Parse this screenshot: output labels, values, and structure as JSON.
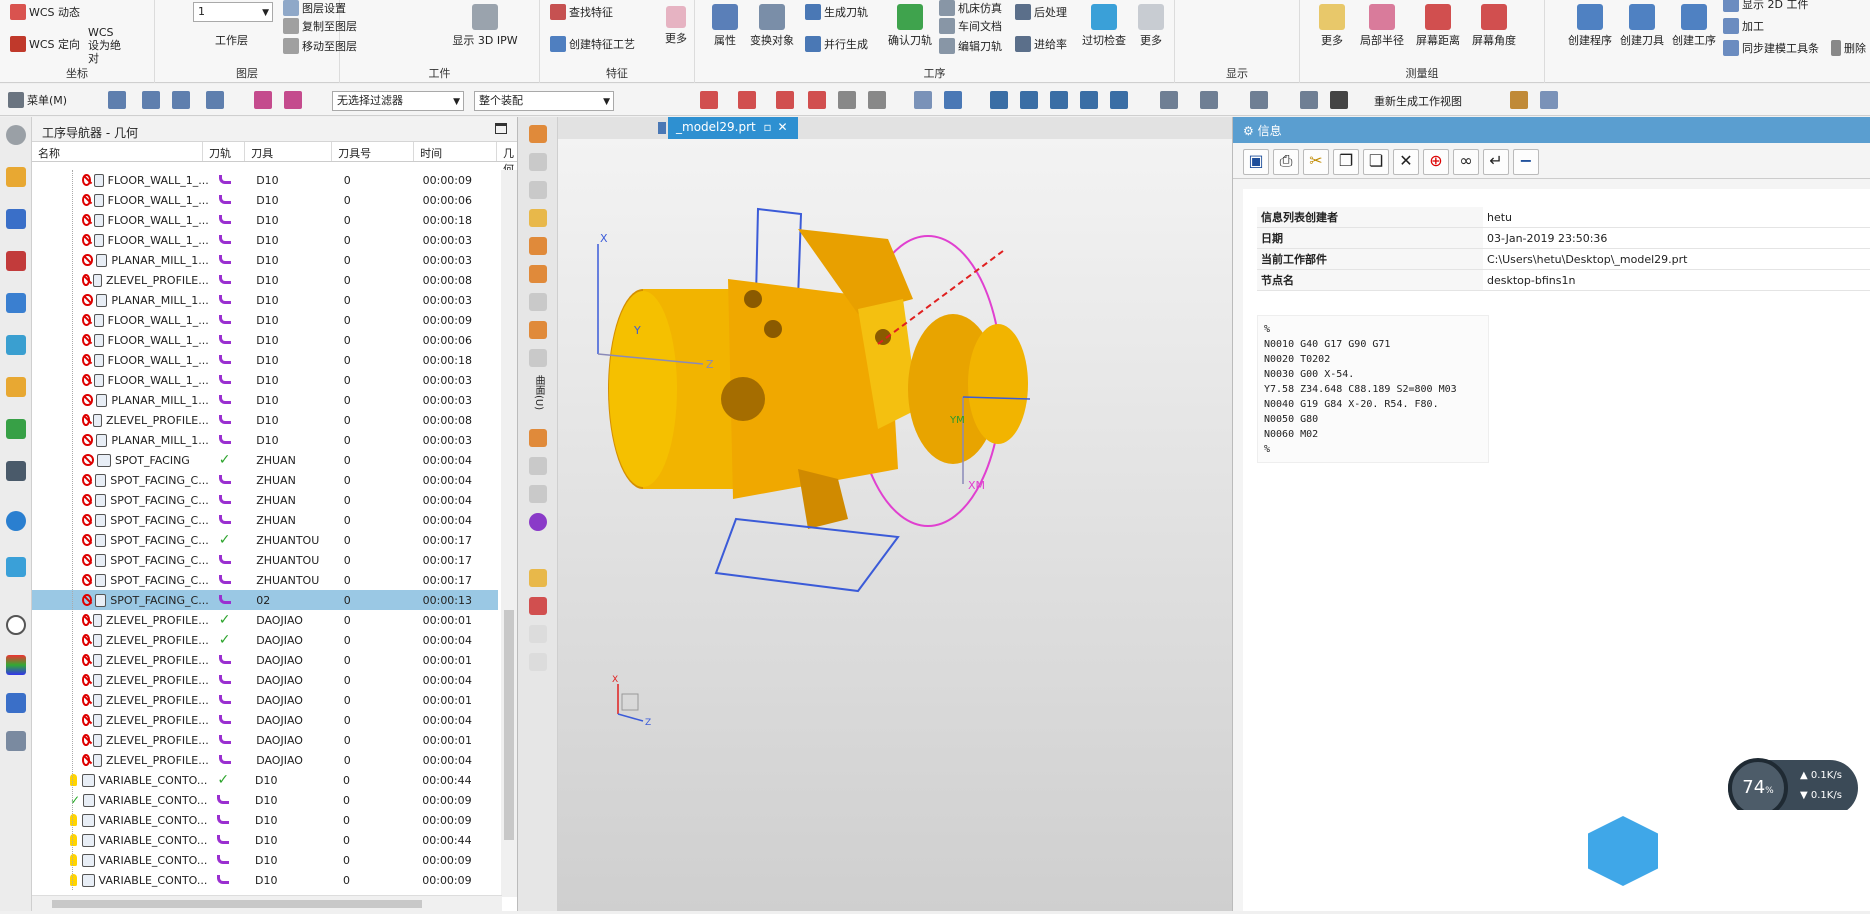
{
  "ribbon": {
    "groups": {
      "coord": "坐标",
      "layer": "图层",
      "workpiece": "工件",
      "feature": "特征",
      "process": "工序",
      "display": "显示",
      "measure": "测量组"
    },
    "coord_buttons": [
      "WCS 动态",
      "WCS 设为绝对",
      "WCS 定向"
    ],
    "layer_select": "1",
    "layer_buttons": [
      "工作层",
      "图层设置",
      "复制至图层",
      "移动至图层"
    ],
    "workpiece_buttons": [
      "显示 3D IPW"
    ],
    "feature_buttons": [
      "查找特征",
      "创建特征工艺",
      "更多"
    ],
    "process_buttons": [
      "属性",
      "变换对象",
      "生成刀轨",
      "并行生成",
      "确认刀轨",
      "机床仿真",
      "车间文档",
      "编辑刀轨",
      "后处理",
      "进给率",
      "过切检查",
      "更多"
    ],
    "measure_buttons": [
      "更多",
      "局部半径",
      "屏幕距离",
      "屏幕角度"
    ],
    "right_buttons": [
      "创建程序",
      "创建刀具",
      "创建工序",
      "显示 2D 工件",
      "加工",
      "同步建模工具条",
      "删除"
    ]
  },
  "quickbar": {
    "menu": "菜单(M)",
    "filter": "无选择过滤器",
    "assembly": "整个装配",
    "regen": "重新生成工作视图"
  },
  "navigator": {
    "title": "工序导航器 - 几何",
    "columns": [
      "名称",
      "刀轨",
      "刀具",
      "刀具号",
      "时间",
      "几何"
    ],
    "rows": [
      {
        "name": "FLOOR_WALL_1_...",
        "tool": "D10",
        "num": "0",
        "time": "00:00:09"
      },
      {
        "name": "FLOOR_WALL_1_...",
        "tool": "D10",
        "num": "0",
        "time": "00:00:06"
      },
      {
        "name": "FLOOR_WALL_1_...",
        "tool": "D10",
        "num": "0",
        "time": "00:00:18"
      },
      {
        "name": "FLOOR_WALL_1_...",
        "tool": "D10",
        "num": "0",
        "time": "00:00:03"
      },
      {
        "name": "PLANAR_MILL_1...",
        "tool": "D10",
        "num": "0",
        "time": "00:00:03"
      },
      {
        "name": "ZLEVEL_PROFILE...",
        "tool": "D10",
        "num": "0",
        "time": "00:00:08"
      },
      {
        "name": "PLANAR_MILL_1...",
        "tool": "D10",
        "num": "0",
        "time": "00:00:03"
      },
      {
        "name": "FLOOR_WALL_1_...",
        "tool": "D10",
        "num": "0",
        "time": "00:00:09"
      },
      {
        "name": "FLOOR_WALL_1_...",
        "tool": "D10",
        "num": "0",
        "time": "00:00:06"
      },
      {
        "name": "FLOOR_WALL_1_...",
        "tool": "D10",
        "num": "0",
        "time": "00:00:18"
      },
      {
        "name": "FLOOR_WALL_1_...",
        "tool": "D10",
        "num": "0",
        "time": "00:00:03"
      },
      {
        "name": "PLANAR_MILL_1...",
        "tool": "D10",
        "num": "0",
        "time": "00:00:03"
      },
      {
        "name": "ZLEVEL_PROFILE...",
        "tool": "D10",
        "num": "0",
        "time": "00:00:08"
      },
      {
        "name": "PLANAR_MILL_1...",
        "tool": "D10",
        "num": "0",
        "time": "00:00:03"
      },
      {
        "name": "SPOT_FACING",
        "tool": "ZHUAN",
        "num": "0",
        "time": "00:00:04"
      },
      {
        "name": "SPOT_FACING_C...",
        "tool": "ZHUAN",
        "num": "0",
        "time": "00:00:04"
      },
      {
        "name": "SPOT_FACING_C...",
        "tool": "ZHUAN",
        "num": "0",
        "time": "00:00:04"
      },
      {
        "name": "SPOT_FACING_C...",
        "tool": "ZHUAN",
        "num": "0",
        "time": "00:00:04"
      },
      {
        "name": "SPOT_FACING_C...",
        "tool": "ZHUANTOU",
        "num": "0",
        "time": "00:00:17"
      },
      {
        "name": "SPOT_FACING_C...",
        "tool": "ZHUANTOU",
        "num": "0",
        "time": "00:00:17"
      },
      {
        "name": "SPOT_FACING_C...",
        "tool": "ZHUANTOU",
        "num": "0",
        "time": "00:00:17"
      },
      {
        "name": "SPOT_FACING_C...",
        "tool": "02",
        "num": "0",
        "time": "00:00:13"
      },
      {
        "name": "ZLEVEL_PROFILE...",
        "tool": "DAOJIAO",
        "num": "0",
        "time": "00:00:01"
      },
      {
        "name": "ZLEVEL_PROFILE...",
        "tool": "DAOJIAO",
        "num": "0",
        "time": "00:00:04"
      },
      {
        "name": "ZLEVEL_PROFILE...",
        "tool": "DAOJIAO",
        "num": "0",
        "time": "00:00:01"
      },
      {
        "name": "ZLEVEL_PROFILE...",
        "tool": "DAOJIAO",
        "num": "0",
        "time": "00:00:04"
      },
      {
        "name": "ZLEVEL_PROFILE...",
        "tool": "DAOJIAO",
        "num": "0",
        "time": "00:00:01"
      },
      {
        "name": "ZLEVEL_PROFILE...",
        "tool": "DAOJIAO",
        "num": "0",
        "time": "00:00:04"
      },
      {
        "name": "ZLEVEL_PROFILE...",
        "tool": "DAOJIAO",
        "num": "0",
        "time": "00:00:01"
      },
      {
        "name": "ZLEVEL_PROFILE...",
        "tool": "DAOJIAO",
        "num": "0",
        "time": "00:00:04"
      },
      {
        "name": "VARIABLE_CONTO...",
        "tool": "D10",
        "num": "0",
        "time": "00:00:44"
      },
      {
        "name": "VARIABLE_CONTO...",
        "tool": "D10",
        "num": "0",
        "time": "00:00:09"
      },
      {
        "name": "VARIABLE_CONTO...",
        "tool": "D10",
        "num": "0",
        "time": "00:00:09"
      },
      {
        "name": "VARIABLE_CONTO...",
        "tool": "D10",
        "num": "0",
        "time": "00:00:44"
      },
      {
        "name": "VARIABLE_CONTO...",
        "tool": "D10",
        "num": "0",
        "time": "00:00:09"
      },
      {
        "name": "VARIABLE_CONTO...",
        "tool": "D10",
        "num": "0",
        "time": "00:00:09"
      }
    ]
  },
  "viewer": {
    "tab": "_model29.prt",
    "axis_labels": {
      "x": "X",
      "y": "Y",
      "z": "Z",
      "xm": "XM",
      "ym": "YM"
    },
    "side_label": "曲面(U)"
  },
  "info": {
    "title": "信息",
    "fields": [
      {
        "k": "信息列表创建者",
        "v": "hetu"
      },
      {
        "k": "日期",
        "v": "03-Jan-2019 23:50:36"
      },
      {
        "k": "当前工作部件",
        "v": "C:\\Users\\hetu\\Desktop\\_model29.prt"
      },
      {
        "k": "节点名",
        "v": "desktop-bfins1n"
      }
    ],
    "code": [
      "%",
      "N0010 G40 G17 G90 G71",
      "N0020 T0202",
      "N0030 G00 X-54.",
      "Y7.58 Z34.648 C88.189 S2=800 M03",
      "N0040 G19 G84 X-20. R54. F80.",
      "N0050 G80",
      "N0060 M02",
      "%"
    ]
  },
  "gauge": {
    "percent": "74",
    "unit": "%",
    "up": "0.1K/s",
    "down": "0.1K/s"
  },
  "colors": {
    "accent": "#2e90d1",
    "part": "#f2b400",
    "selection": "#9ac8e4"
  }
}
